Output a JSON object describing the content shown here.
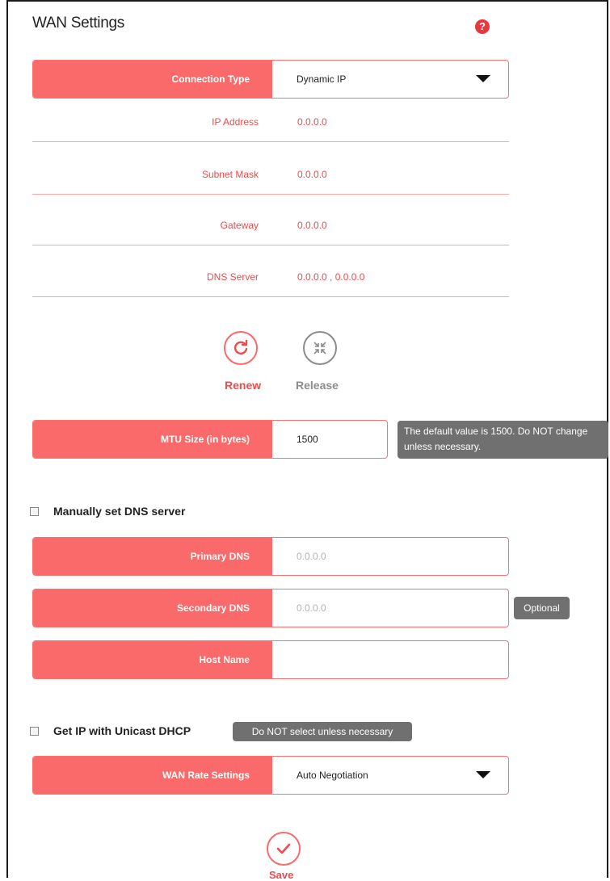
{
  "header": {
    "title": "WAN Settings",
    "help_icon": "question-circle-icon"
  },
  "connection_type": {
    "label": "Connection Type",
    "value": "Dynamic IP"
  },
  "info": [
    {
      "label": "IP Address",
      "value": "0.0.0.0"
    },
    {
      "label": "Subnet Mask",
      "value": "0.0.0.0"
    },
    {
      "label": "Gateway",
      "value": "0.0.0.0"
    },
    {
      "label": "DNS Server",
      "value": "0.0.0.0 , 0.0.0.0"
    }
  ],
  "actions": {
    "renew": "Renew",
    "release": "Release"
  },
  "mtu": {
    "label": "MTU Size (in bytes)",
    "value": "1500",
    "tip": "The default value is 1500. Do NOT change unless necessary."
  },
  "manual_dns": {
    "label": "Manually set DNS server",
    "checked": false
  },
  "primary_dns": {
    "label": "Primary DNS",
    "placeholder": "0.0.0.0"
  },
  "secondary_dns": {
    "label": "Secondary DNS",
    "placeholder": "0.0.0.0",
    "tip": "Optional"
  },
  "host_name": {
    "label": "Host Name",
    "value": ""
  },
  "unicast_dhcp": {
    "label": "Get IP with Unicast DHCP",
    "checked": false,
    "tip": "Do NOT select unless necessary"
  },
  "wan_rate": {
    "label": "WAN Rate Settings",
    "value": "Auto Negotiation"
  },
  "save": {
    "label": "Save"
  },
  "colors": {
    "accent": "#fb6a6a",
    "accent_text": "#f14a4a",
    "tooltip": "#707070",
    "grey_icon": "#8c8c8c"
  }
}
